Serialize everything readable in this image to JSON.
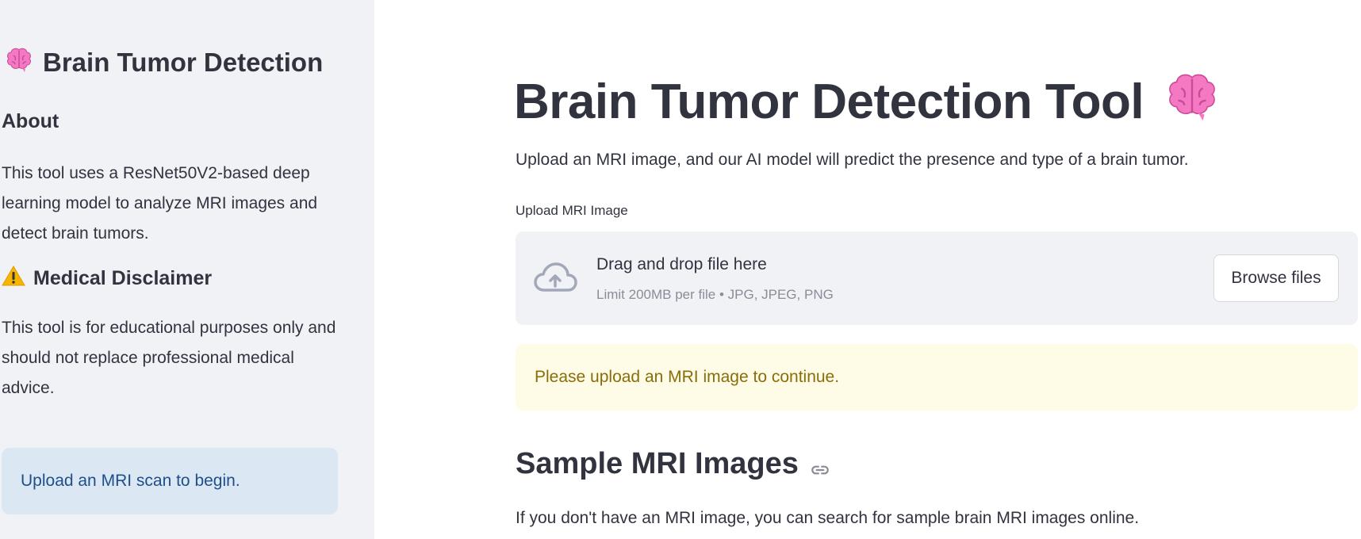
{
  "sidebar": {
    "title": "Brain Tumor Detection",
    "title_icon": "brain-icon",
    "about_heading": "About",
    "about_text": "This tool uses a ResNet50V2-based deep learning model to analyze MRI images and detect brain tumors.",
    "disclaimer_heading": "Medical Disclaimer",
    "disclaimer_icon": "warning-icon",
    "disclaimer_text": "This tool is for educational purposes only and should not replace professional medical advice.",
    "info_text": "Upload an MRI scan to begin."
  },
  "main": {
    "title": "Brain Tumor Detection Tool",
    "title_icon": "brain-icon",
    "subtitle": "Upload an MRI image, and our AI model will predict the presence and type of a brain tumor.",
    "uploader": {
      "label": "Upload MRI Image",
      "drag_text": "Drag and drop file here",
      "limit_text": "Limit 200MB per file • JPG, JPEG, PNG",
      "browse_label": "Browse files",
      "icon": "cloud-upload-icon"
    },
    "warning_text": "Please upload an MRI image to continue.",
    "sample_heading": "Sample MRI Images",
    "sample_text": "If you don't have an MRI image, you can search for sample brain MRI images online."
  },
  "colors": {
    "sidebar_bg": "#f0f2f6",
    "info_bg": "#dce7f4",
    "info_text": "#1e4f8a",
    "warning_bg": "#fefce6",
    "warning_text": "#8a6d0b",
    "text": "#31333f"
  }
}
